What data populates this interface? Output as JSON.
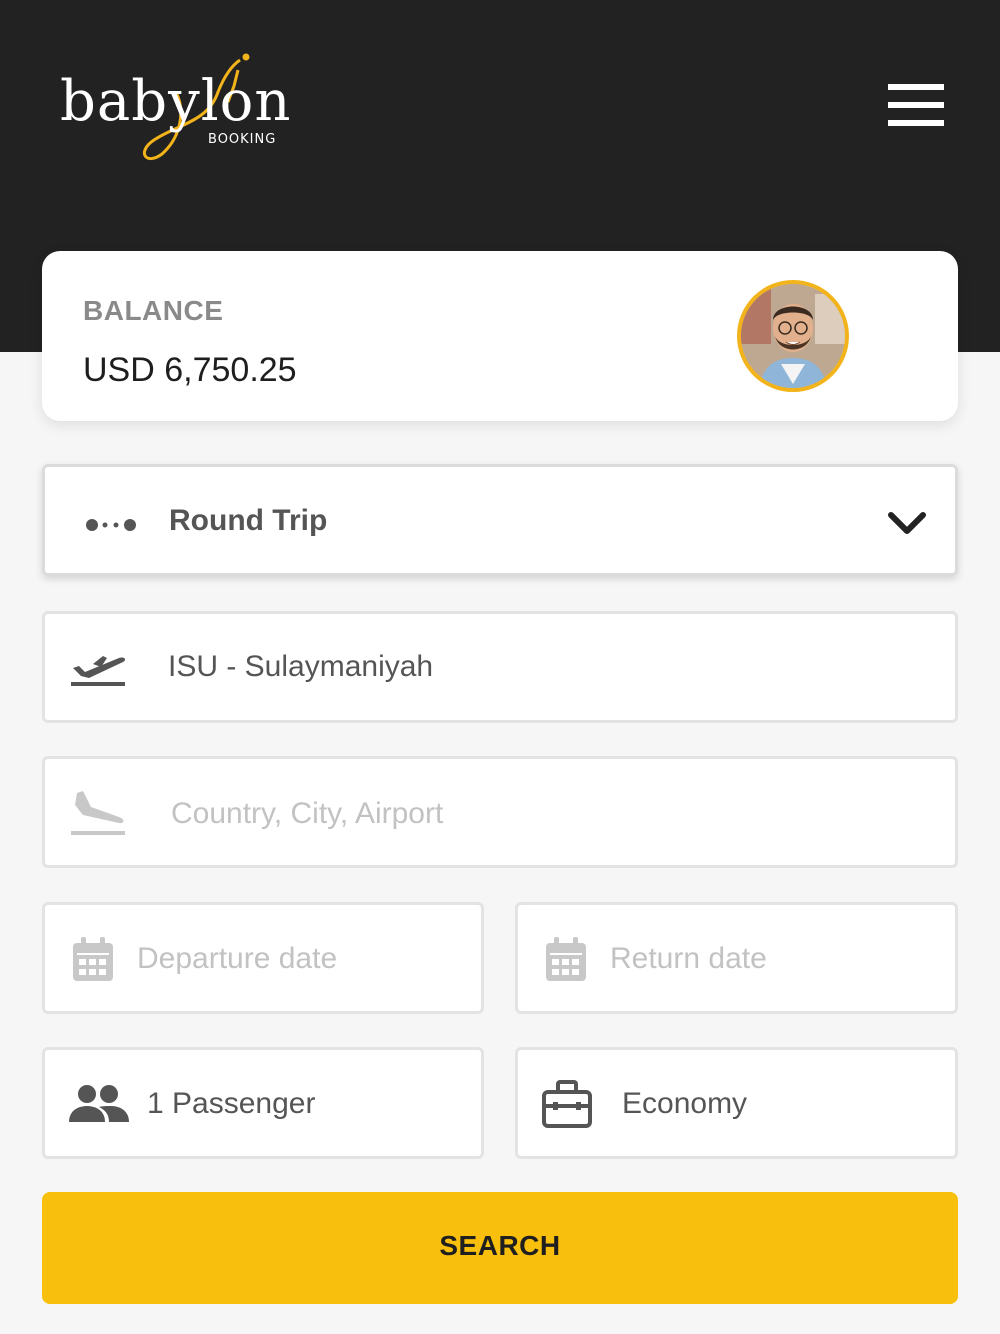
{
  "header": {
    "logo_word": "babylon",
    "logo_sub": "BOOKING",
    "menu_icon": "hamburger-menu-icon"
  },
  "balance": {
    "label": "BALANCE",
    "value": "USD 6,750.25",
    "avatar_icon": "user-avatar"
  },
  "trip_type": {
    "icon": "round-trip-icon",
    "selected": "Round Trip",
    "chevron_icon": "chevron-down-icon"
  },
  "origin": {
    "icon": "takeoff-icon",
    "value": "ISU - Sulaymaniyah"
  },
  "destination": {
    "icon": "landing-icon",
    "placeholder": "Country, City, Airport"
  },
  "departure": {
    "icon": "calendar-icon",
    "placeholder": "Departure date"
  },
  "return": {
    "icon": "calendar-icon",
    "placeholder": "Return date"
  },
  "passengers": {
    "icon": "people-icon",
    "value": "1 Passenger"
  },
  "cabin": {
    "icon": "briefcase-icon",
    "value": "Economy"
  },
  "search": {
    "label": "SEARCH"
  },
  "colors": {
    "header_bg": "#222222",
    "accent": "#f8bf0c",
    "page_bg": "#f6f6f6"
  }
}
